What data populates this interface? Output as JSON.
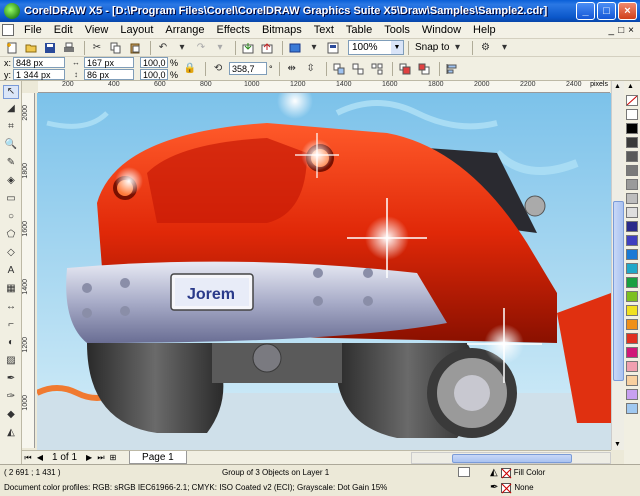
{
  "window": {
    "title": "CorelDRAW X5 - [D:\\Program Files\\Corel\\CorelDRAW Graphics Suite X5\\Draw\\Samples\\Sample2.cdr]",
    "minimize": "_",
    "maximize": "□",
    "close": "×"
  },
  "menu": {
    "items": [
      "File",
      "Edit",
      "View",
      "Layout",
      "Arrange",
      "Effects",
      "Bitmaps",
      "Text",
      "Table",
      "Tools",
      "Window",
      "Help"
    ],
    "doc_controls": [
      "_",
      "□",
      "×"
    ]
  },
  "toolbar": {
    "zoom_value": "100%",
    "snap_label": "Snap to"
  },
  "property_bar": {
    "x_label": "x:",
    "x_value": "848 px",
    "y_label": "y:",
    "y_value": "1 344 px",
    "width_value": "167 px",
    "height_value": "86 px",
    "scale_x": "100,0",
    "scale_y": "100,0",
    "percent": "%",
    "rotation_value": "358,7",
    "degree": "°"
  },
  "ruler": {
    "units": "pixels",
    "top_ticks": [
      "200",
      "400",
      "600",
      "800",
      "1000",
      "1200",
      "1400",
      "1600",
      "1800",
      "2000",
      "2200",
      "2400"
    ],
    "left_ticks": [
      "2000",
      "1800",
      "1600",
      "1400",
      "1200",
      "1000"
    ]
  },
  "canvas": {
    "plate_text": "Jorem"
  },
  "page_nav": {
    "page_count": "1 of 1",
    "page_tab": "Page 1"
  },
  "status": {
    "coords": "( 2 691 ; 1 431 )",
    "selection": "Group of 3 Objects on Layer 1",
    "color_profiles": "Document color profiles: RGB: sRGB IEC61966-2.1; CMYK: ISO Coated v2 (ECI); Grayscale: Dot Gain 15%",
    "fill_label": "Fill Color",
    "outline_label": "None"
  },
  "palette_colors": [
    "#ffffff",
    "#000000",
    "#3a3a3a",
    "#5a5a5a",
    "#7a7a7a",
    "#9a9a9a",
    "#bdbdbd",
    "#dedede",
    "#2a2a8a",
    "#3f3fc0",
    "#1a7ad6",
    "#20a8c8",
    "#18a040",
    "#7cc020",
    "#f0e020",
    "#f09018",
    "#e03020",
    "#d01878",
    "#f0a0b0",
    "#f8d0a0",
    "#c8a0f0",
    "#a0c8f0"
  ]
}
